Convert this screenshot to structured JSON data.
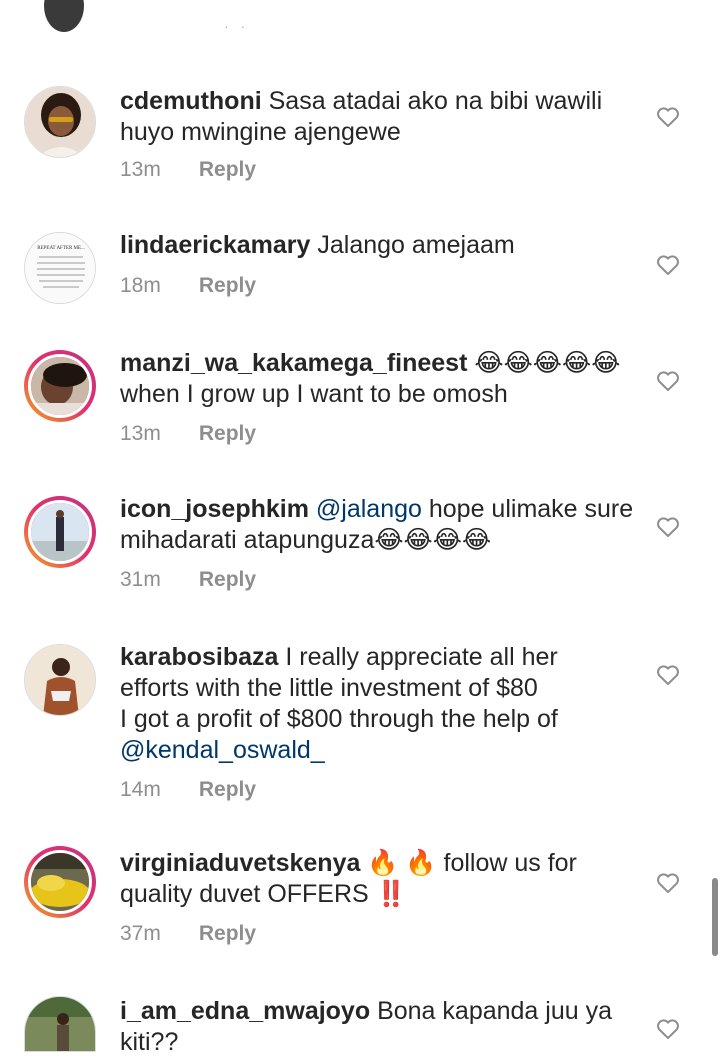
{
  "top_fragment": {
    "dots": "· ·"
  },
  "comments": [
    {
      "username": "cdemuthoni",
      "line1": "Sasa atadai ako na bibi wawili",
      "line2": "huyo mwingine ajengewe",
      "time": "13m",
      "reply": "Reply"
    },
    {
      "username": "lindaerickamary",
      "line1": "Jalango amejaam",
      "time": "18m",
      "reply": "Reply",
      "avatar_text": "REPEAT AFTER ME..."
    },
    {
      "username": "manzi_wa_kakamega_fineest",
      "emoji": "😂😂😂😂😂",
      "line2": "when I grow up I want to be omosh",
      "time": "13m",
      "reply": "Reply"
    },
    {
      "username": "icon_josephkim",
      "mention": "@jalango",
      "line1": "hope ulimake sure",
      "line2": "mihadarati atapunguza😂😂😂😂",
      "time": "31m",
      "reply": "Reply"
    },
    {
      "username": "karabosibaza",
      "line1": "I really appreciate all her",
      "line2": "efforts with the little investment of $80",
      "line3": "I got a profit of $800 through the help of",
      "mention": "@kendal_oswald_",
      "time": "14m",
      "reply": "Reply"
    },
    {
      "username": "virginiaduvetskenya",
      "emoji": "🔥 🔥",
      "line1": "follow us for",
      "line2": "quality duvet OFFERS ‼️",
      "time": "37m",
      "reply": "Reply"
    },
    {
      "username": "i_am_edna_mwajoyo",
      "line1": "Bona kapanda juu ya",
      "line2": "kiti??"
    }
  ],
  "icons": {
    "like": "heart-outline-icon"
  },
  "colors": {
    "text": "#262626",
    "meta": "#8e8e8e",
    "mention": "#00376b"
  }
}
